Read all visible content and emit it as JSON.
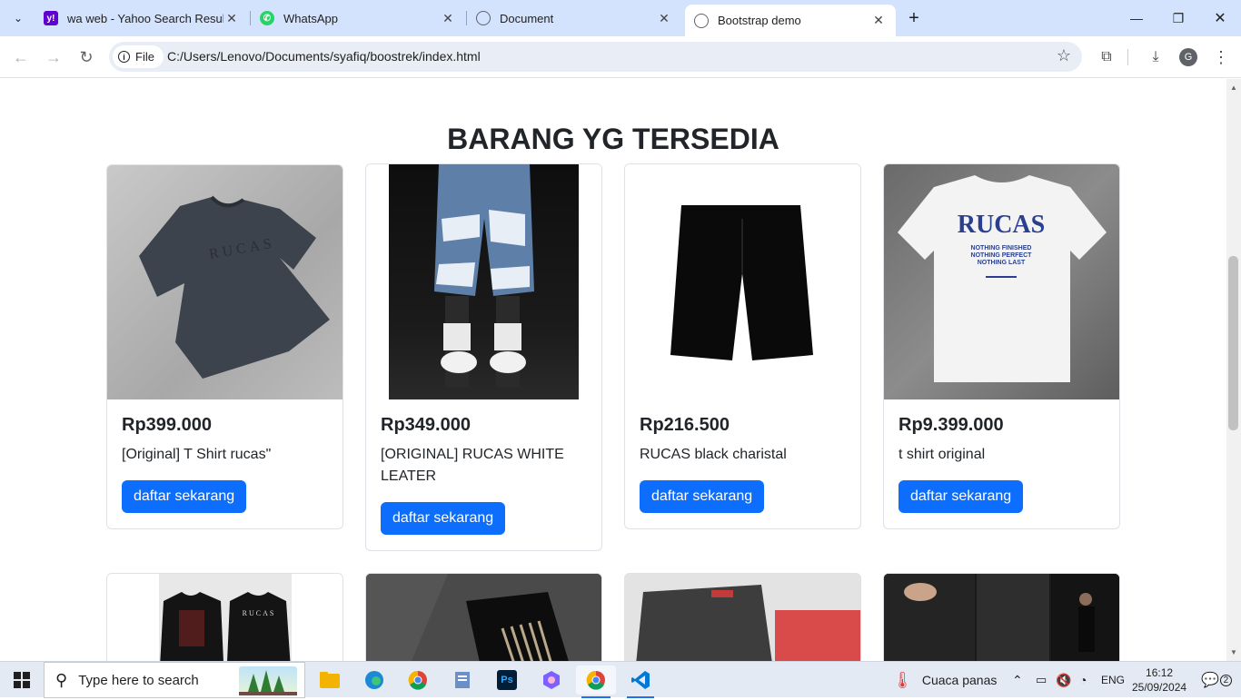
{
  "browser": {
    "tabs": [
      {
        "title": "wa web - Yahoo Search Results",
        "favicon": "yahoo-icon",
        "color": "#6001d2"
      },
      {
        "title": "WhatsApp",
        "favicon": "whatsapp-icon",
        "color": "#25d366"
      },
      {
        "title": "Document",
        "favicon": "globe-icon",
        "color": "#5f6368"
      },
      {
        "title": "Bootstrap demo",
        "favicon": "globe-icon",
        "color": "#5f6368"
      }
    ],
    "address": {
      "chip_label": "File",
      "url": "C:/Users/Lenovo/Documents/syafiq/boostrek/index.html"
    },
    "profile_initial": "G"
  },
  "page": {
    "heading": "BARANG YG TERSEDIA",
    "products": [
      {
        "price": "Rp399.000",
        "name": "[Original] T Shirt rucas\"",
        "button": "daftar sekarang",
        "image": "grey-tshirt-rucas"
      },
      {
        "price": "Rp349.000",
        "name": "[ORIGINAL] RUCAS WHITE LEATER",
        "button": "daftar sekarang",
        "image": "ripped-denim-shorts"
      },
      {
        "price": "Rp216.500",
        "name": "RUCAS black charistal",
        "button": "daftar sekarang",
        "image": "black-shorts"
      },
      {
        "price": "Rp9.399.000",
        "name": "t shirt original",
        "button": "daftar sekarang",
        "image": "white-tshirt-rucas"
      }
    ],
    "tshirt_print": "RUCAS",
    "white_tshirt_lines": [
      "NOTHING FINISHED",
      "NOTHING PERFECT",
      "NOTHING LAST"
    ]
  },
  "taskbar": {
    "search_placeholder": "Type here to search",
    "weather": "Cuaca panas",
    "language": "ENG",
    "time": "16:12",
    "date": "25/09/2024",
    "notification_count": "2"
  },
  "colors": {
    "accent": "#0d6efd",
    "tabstrip": "#d3e3fd"
  }
}
